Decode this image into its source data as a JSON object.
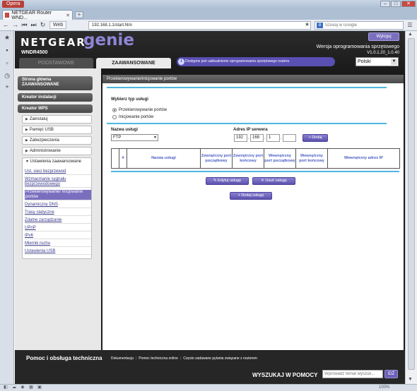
{
  "browser": {
    "opera_label": "Opera",
    "tab_title": "NETGEAR Router WND...",
    "web_label": "Web",
    "url": "192.168.1.1/start.htm",
    "search_placeholder": "Szukaj w Google",
    "zoom": "100%"
  },
  "header": {
    "logo_brand": "NETGEAR",
    "logo_product": "genie",
    "model": "WNDR4500",
    "logout_label": "Wyloguj",
    "fw_label": "Wersja oprogramowania sprzętowego",
    "fw_version": "V1.0.1.20_1.0.40",
    "tab_basic": "PODSTAWOWE",
    "tab_advanced": "ZAAWANSOWANE",
    "update_banner": "Dostępne jest uaktualnienie oprogramowania sprzętowego routera",
    "language": "Polski"
  },
  "sidebar": {
    "home": "Strona główna ZAAWANSOWANE",
    "setup_wizard": "Kreator instalacji",
    "wps_wizard": "Kreator WPS",
    "sections": [
      {
        "label": "Zainstaluj"
      },
      {
        "label": "Pamięć USB"
      },
      {
        "label": "Zabezpieczenia"
      },
      {
        "label": "Administrowanie"
      }
    ],
    "advanced_settings": "Ustawienia zaawansowane",
    "advanced_items": [
      {
        "label": "Ust. sieci bezprzewod"
      },
      {
        "label": "Wzmacnianie sygnału bezprzewodowego"
      },
      {
        "label": "Przekierowywanie/ inicjowanie portów"
      },
      {
        "label": "Dynamiczny DNS"
      },
      {
        "label": "Trasy statyczne"
      },
      {
        "label": "Zdalne zarządzanie"
      },
      {
        "label": "UPnP"
      },
      {
        "label": "IPv6"
      },
      {
        "label": "Miernik ruchu"
      },
      {
        "label": "Ustawienia USB"
      }
    ]
  },
  "content": {
    "title": "Przekierowywanie/inicjowanie portów",
    "select_type_label": "Wybierz typ usługi",
    "radio_forwarding": "Przekierowywanie portów",
    "radio_triggering": "Inicjowanie portów",
    "service_name_label": "Nazwa usługi",
    "service_value": "FTP",
    "server_ip_label": "Adres IP serwera",
    "ip": [
      "192",
      "168",
      "1",
      ""
    ],
    "add_btn": "Dodaj",
    "table_headers": [
      "",
      "#",
      "Nazwa usługi",
      "Zewnętrzny port początkowy",
      "Zewnętrzny port końcowy",
      "Wewnętrzny port początkowy",
      "Wewnętrzny port końcowy",
      "Wewnętrzny adres IP"
    ],
    "edit_btn": "Edytuj usługę",
    "delete_btn": "Usuń usługę",
    "add_service_btn": "Dodaj usługę"
  },
  "footer": {
    "help_title": "Pomoc i obsługa techniczna",
    "links": [
      "Dokumentacja",
      "Pomoc techniczna online",
      "Często zadawane pytania związane z routerem"
    ],
    "search_label": "WYSZUKAJ W POMOCY",
    "search_placeholder": "Wprowadź temat wyszuk...",
    "go_label": "IDŹ"
  }
}
